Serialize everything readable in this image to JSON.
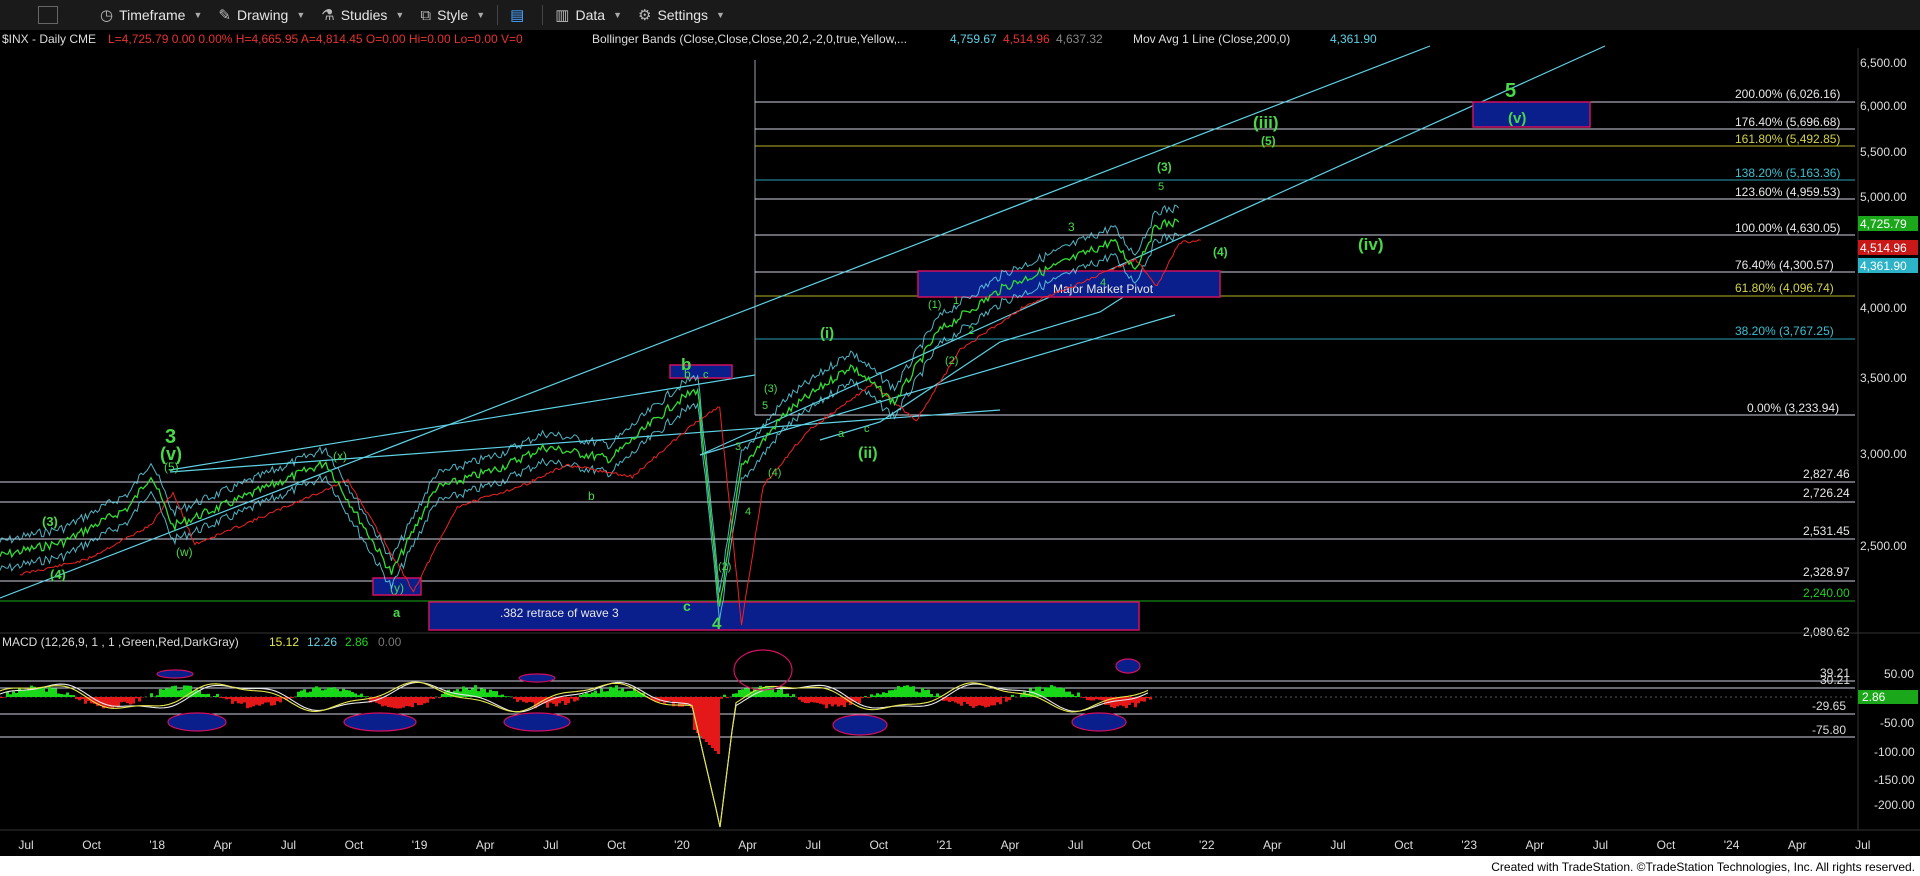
{
  "toolbar": {
    "items": [
      {
        "label": "Timeframe",
        "icon": "clock-icon"
      },
      {
        "label": "Drawing",
        "icon": "pencil-icon"
      },
      {
        "label": "Studies",
        "icon": "flask-icon"
      },
      {
        "label": "Style",
        "icon": "chart-style-icon"
      },
      {
        "label": "Data",
        "icon": "bar-data-icon"
      },
      {
        "label": "Settings",
        "icon": "gear-icon"
      }
    ]
  },
  "header": {
    "symbol": "$INX - Daily  CME",
    "quote": "L=4,725.79  0.00  0.00%  H=4,665.95  A=4,814.45  O=0.00  Hi=0.00  Lo=0.00  V=0",
    "bb_label": "Bollinger Bands (Close,Close,Close,20,2,-2,0,true,Yellow,...",
    "bb_values": [
      "4,759.67",
      "4,514.96",
      "4,637.32"
    ],
    "ma_label": "Mov Avg 1 Line (Close,200,0)",
    "ma_value": "4,361.90"
  },
  "colors": {
    "price": "#33dd33",
    "bb_band": "#5fd3e6",
    "ma": "#ee2222",
    "hline": "#cfd6ea",
    "label_green": "#4ad84a",
    "box_fill": "#0a1e8c",
    "box_border": "#d01060",
    "macd_line": "#e8e8e8",
    "signal_line": "#e6e64a",
    "hist_pos": "#19d819",
    "hist_neg": "#e41818"
  },
  "macd": {
    "label": "MACD (12,26,9, 1 , 1 ,Green,Red,DarkGray)",
    "values": [
      "15.12",
      "12.26",
      "2.86",
      "0.00"
    ],
    "axis": [
      "50.00",
      "-50.00",
      "-100.00",
      "-150.00",
      "-200.00"
    ],
    "levels": [
      "39.21",
      "30.21",
      "-29.65",
      "-75.80"
    ],
    "current": "2.86"
  },
  "price_axis": [
    "6,500.00",
    "6,000.00",
    "5,500.00",
    "5,000.00",
    "4,000.00",
    "3,500.00",
    "3,000.00",
    "2,500.00"
  ],
  "price_tags": [
    "4,725.79",
    "4,514.96",
    "4,361.90"
  ],
  "fib_labels": [
    "200.00% (6,026.16)",
    "176.40% (5,696.68)",
    "161.80% (5,492.85)",
    "138.20% (5,163.36)",
    "123.60% (4,959.53)",
    "100.00% (4,630.05)",
    "76.40% (4,300.57)",
    "61.80% (4,096.74)",
    "38.20% (3,767.25)",
    "0.00% (3,233.94)"
  ],
  "support_levels": [
    "2,827.46",
    "2,726.24",
    "2,531.45",
    "2,328.97",
    "2,240.00",
    "2,080.62"
  ],
  "boxes": [
    ".382 retrace of wave 3",
    "Major Market Pivot",
    "(v)",
    "(y)",
    "b"
  ],
  "wave_labels": [
    "3",
    "(v)",
    "(5)",
    "(3)",
    "(4)",
    "(w)",
    "(x)",
    "a",
    "b",
    "b",
    "c",
    "c",
    "4",
    "(i)",
    "(ii)",
    "(iii)",
    "(iv)",
    "(3)",
    "(4)",
    "(5)",
    "5",
    "3",
    "4",
    "(1)",
    "(2)",
    "(3)",
    "(4)",
    "(2)",
    "1",
    "2",
    "3",
    "4",
    "5",
    "a",
    "c",
    "5"
  ],
  "x_axis": [
    "Jul",
    "Oct",
    "'18",
    "Apr",
    "Jul",
    "Oct",
    "'19",
    "Apr",
    "Jul",
    "Oct",
    "'20",
    "Apr",
    "Jul",
    "Oct",
    "'21",
    "Apr",
    "Jul",
    "Oct",
    "'22",
    "Apr",
    "Jul",
    "Oct",
    "'23",
    "Apr",
    "Jul",
    "Oct",
    "'24",
    "Apr",
    "Jul"
  ],
  "footer": "Created with TradeStation. ©TradeStation Technologies, Inc. All rights reserved.",
  "chart_data": {
    "type": "line",
    "title": "$INX - Daily",
    "series": [
      {
        "name": "$INX",
        "x": [
          "2017-06",
          "2017-09",
          "2017-12",
          "2018-01",
          "2018-02",
          "2018-05",
          "2018-09",
          "2018-12",
          "2019-02",
          "2019-05",
          "2019-07",
          "2019-10",
          "2020-01",
          "2020-02",
          "2020-03",
          "2020-04",
          "2020-06",
          "2020-09",
          "2020-11",
          "2021-01",
          "2021-04",
          "2021-06",
          "2021-09",
          "2021-10",
          "2021-11",
          "2021-12"
        ],
        "values": [
          2430,
          2500,
          2680,
          2860,
          2580,
          2720,
          2930,
          2350,
          2780,
          2900,
          3020,
          2950,
          3300,
          3390,
          2200,
          2900,
          3230,
          3550,
          3300,
          3800,
          4150,
          4300,
          4550,
          4310,
          4700,
          4725
        ]
      }
    ],
    "ylim": [
      2080,
      6550
    ]
  }
}
